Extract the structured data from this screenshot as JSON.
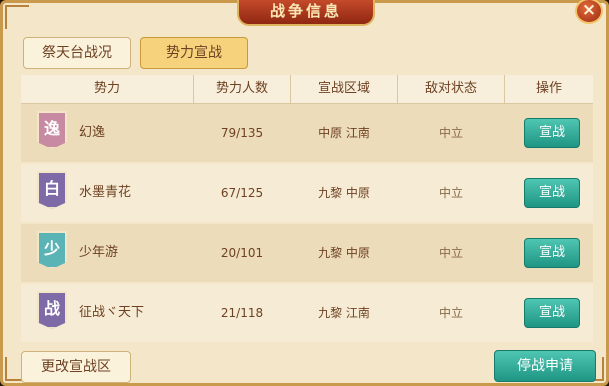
{
  "window": {
    "title": "战争信息",
    "close_glyph": "×"
  },
  "tabs": [
    {
      "label": "祭天台战况",
      "active": false
    },
    {
      "label": "势力宣战",
      "active": true
    }
  ],
  "table": {
    "headers": [
      "势力",
      "势力人数",
      "宣战区域",
      "敌对状态",
      "操作"
    ],
    "rows": [
      {
        "badge": "逸",
        "badge_color": "#c78aa2",
        "name": "幻逸",
        "members": "79/135",
        "region": "中原 江南",
        "status": "中立",
        "action": "宣战"
      },
      {
        "badge": "白",
        "badge_color": "#7f6aa8",
        "name": "水墨青花",
        "members": "67/125",
        "region": "九黎 中原",
        "status": "中立",
        "action": "宣战"
      },
      {
        "badge": "少",
        "badge_color": "#5ab4b6",
        "name": "少年游",
        "members": "20/101",
        "region": "九黎 中原",
        "status": "中立",
        "action": "宣战"
      },
      {
        "badge": "战",
        "badge_color": "#7f6aa8",
        "name": "征战ヾ天下",
        "members": "21/118",
        "region": "九黎 江南",
        "status": "中立",
        "action": "宣战"
      }
    ]
  },
  "footer": {
    "change_zone": "更改宣战区",
    "stop_war": "停战申请"
  }
}
